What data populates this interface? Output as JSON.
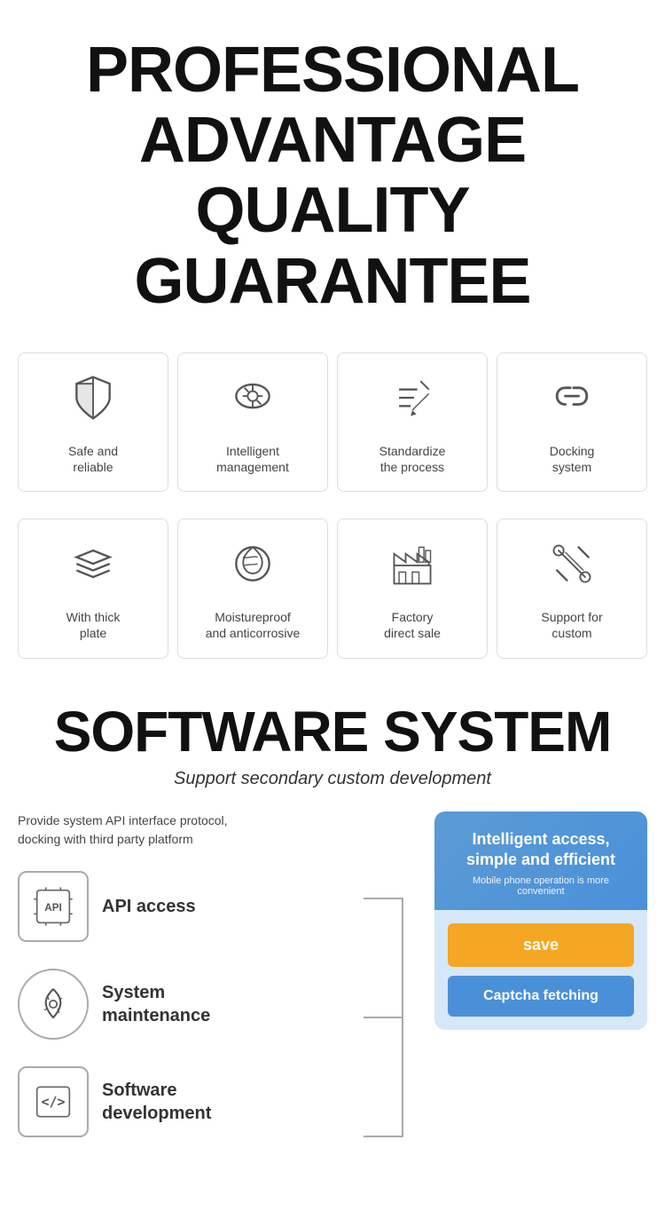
{
  "header": {
    "line1": "PROFESSIONAL",
    "line2": "ADVANTAGE",
    "line3": "QUALITY GUARANTEE"
  },
  "grid1": {
    "items": [
      {
        "id": "safe-reliable",
        "label": "Safe and\nreliable",
        "icon": "shield"
      },
      {
        "id": "intelligent-management",
        "label": "Intelligent\nmanagement",
        "icon": "cloud"
      },
      {
        "id": "standardize-process",
        "label": "Standardize\nthe process",
        "icon": "pencil"
      },
      {
        "id": "docking-system",
        "label": "Docking\nsystem",
        "icon": "link"
      }
    ]
  },
  "grid2": {
    "items": [
      {
        "id": "thick-plate",
        "label": "With thick\nplate",
        "icon": "layers"
      },
      {
        "id": "moistureproof",
        "label": "Moistureproof\nand anticorrosive",
        "icon": "leaf"
      },
      {
        "id": "factory-direct",
        "label": "Factory\ndirect sale",
        "icon": "factory"
      },
      {
        "id": "support-custom",
        "label": "Support for\ncustom",
        "icon": "tools"
      }
    ]
  },
  "software": {
    "title": "SOFTWARE SYSTEM",
    "subtitle": "Support secondary custom development",
    "desc": "Provide system API interface protocol,\ndocking with third party platform",
    "features": [
      {
        "id": "api-access",
        "label": "API access",
        "icon": "api"
      },
      {
        "id": "system-maintenance",
        "label": "System\nmaintenance",
        "icon": "maintenance"
      },
      {
        "id": "software-development",
        "label": "Software\ndevelopment",
        "icon": "code"
      }
    ],
    "panel": {
      "title": "Intelligent access,\nsimple and efficient",
      "subtitle": "Mobile phone operation is more\nconvenient",
      "btn_save": "save",
      "btn_captcha": "Captcha fetching"
    }
  }
}
